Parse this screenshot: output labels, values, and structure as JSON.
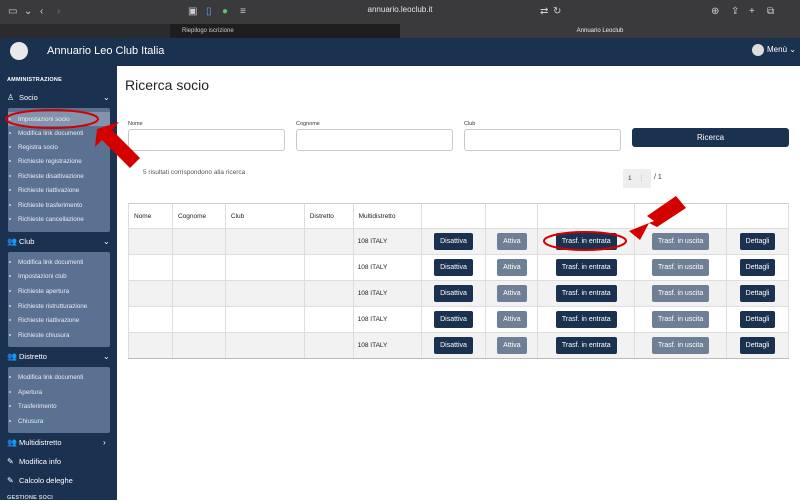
{
  "browser": {
    "url": "annuario.leoclub.it",
    "tabs": [
      {
        "label": "Riepilogo iscrizione"
      },
      {
        "label": "Annuario Leoclub"
      }
    ]
  },
  "app": {
    "title": "Annuario Leo Club Italia",
    "menu_label": "Menù"
  },
  "sidebar": {
    "section_admin": "AMMINISTRAZIONE",
    "groups": [
      {
        "label": "Socio",
        "items": [
          "Impostazioni socio",
          "Modifica link documenti",
          "Registra socio",
          "Richieste registrazione",
          "Richieste disattivazione",
          "Richieste riattivazione",
          "Richieste trasferimento",
          "Richieste cancellazione"
        ]
      },
      {
        "label": "Club",
        "items": [
          "Modifica link documenti",
          "Impostazioni club",
          "Richieste apertura",
          "Richieste ristrutturazione",
          "Richieste riattivazione",
          "Richieste chiusura"
        ]
      },
      {
        "label": "Distretto",
        "items": [
          "Modifica link documenti",
          "Apertura",
          "Trasferimento",
          "Chiusura"
        ]
      },
      {
        "label": "Multidistretto",
        "items": []
      }
    ],
    "links": [
      "Modifica info",
      "Calcolo deleghe"
    ],
    "section_bottom": "GESTIONE SOCI"
  },
  "main": {
    "title": "Ricerca socio",
    "form": {
      "nome_label": "Nome",
      "cognome_label": "Cognome",
      "club_label": "Club",
      "search_button": "Ricerca"
    },
    "results_text": "5 risultati corrispondono alla ricerca",
    "pagination": {
      "current": "1",
      "total": "/ 1"
    },
    "table": {
      "headers": [
        "Nome",
        "Cognome",
        "Club",
        "Distretto",
        "Multidistretto",
        "",
        "",
        "",
        "",
        ""
      ],
      "rows": [
        {
          "multidistretto": "108 ITALY"
        },
        {
          "multidistretto": "108 ITALY"
        },
        {
          "multidistretto": "108 ITALY"
        },
        {
          "multidistretto": "108 ITALY"
        },
        {
          "multidistretto": "108 ITALY"
        }
      ],
      "buttons": {
        "disattiva": "Disattiva",
        "attiva": "Attiva",
        "trasf_entrata": "Trasf. in entrata",
        "trasf_uscita": "Trasf. in uscita",
        "dettagli": "Dettagli"
      }
    }
  },
  "colors": {
    "brand_navy": "#1b3150",
    "sidebar_sub": "#5b7191",
    "button_gray": "#6f7f96",
    "annotation_red": "#d40000"
  }
}
